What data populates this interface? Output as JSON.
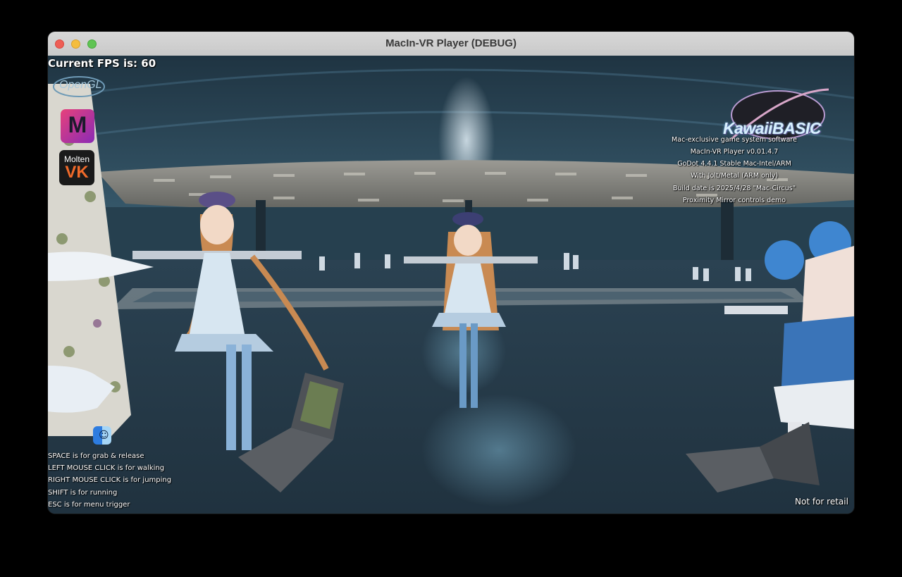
{
  "window": {
    "title": "MacIn-VR Player (DEBUG)"
  },
  "hud": {
    "fps_text": "Current FPS is: 60",
    "renderer_logos": {
      "opengl": "OpenGL",
      "metal_letter": "M",
      "moltenvk_top": "Molten",
      "moltenvk_bottom": "VK"
    },
    "brand_logo": "KawaiiBASIC",
    "info_lines": [
      "Mac-exclusive game system software",
      "MacIn-VR Player v0.01.4.7",
      "GoDot 4.4.1 Stable Mac-Intel/ARM",
      "With Jolt/Metal (ARM only)",
      "Build date is 2025/4/28 \"Mac-Circus\"",
      "Proximity Mirror controls demo"
    ],
    "controls": [
      "SPACE is for grab & release",
      "LEFT MOUSE CLICK is for walking",
      "RIGHT MOUSE CLICK is for jumping",
      "SHIFT is for running",
      "ESC is for menu trigger"
    ],
    "footer": "Not for retail",
    "finder_face": "☺"
  },
  "colors": {
    "sky": "#2a4a5e",
    "floor": "#2c4556",
    "ceiling": "#8a8a86",
    "character_dress": "#c8dceb",
    "character_hair": "#c98a52",
    "right_character_hair": "#3f86d0",
    "laptop": "#55585c"
  }
}
